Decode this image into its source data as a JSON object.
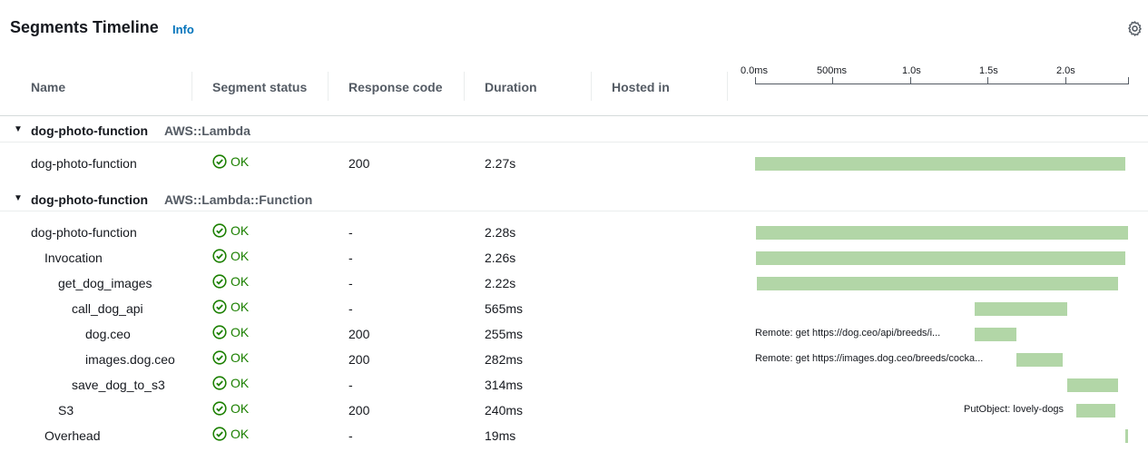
{
  "panel": {
    "title": "Segments Timeline",
    "info_label": "Info"
  },
  "columns": {
    "name": "Name",
    "status": "Segment status",
    "response": "Response code",
    "duration": "Duration",
    "hosted": "Hosted in"
  },
  "axis": {
    "ticks": [
      "0.0ms",
      "500ms",
      "1.0s",
      "1.5s",
      "2.0s"
    ]
  },
  "groups": [
    {
      "name": "dog-photo-function",
      "type": "AWS::Lambda"
    },
    {
      "name": "dog-photo-function",
      "type": "AWS::Lambda::Function"
    }
  ],
  "rows": [
    {
      "name": "dog-photo-function",
      "status": "OK",
      "response": "200",
      "duration": "2.27s",
      "bar_label": ""
    },
    {
      "name": "dog-photo-function",
      "status": "OK",
      "response": "-",
      "duration": "2.28s",
      "bar_label": ""
    },
    {
      "name": "Invocation",
      "status": "OK",
      "response": "-",
      "duration": "2.26s",
      "bar_label": ""
    },
    {
      "name": "get_dog_images",
      "status": "OK",
      "response": "-",
      "duration": "2.22s",
      "bar_label": ""
    },
    {
      "name": "call_dog_api",
      "status": "OK",
      "response": "-",
      "duration": "565ms",
      "bar_label": ""
    },
    {
      "name": "dog.ceo",
      "status": "OK",
      "response": "200",
      "duration": "255ms",
      "bar_label": "Remote: get https://dog.ceo/api/breeds/i..."
    },
    {
      "name": "images.dog.ceo",
      "status": "OK",
      "response": "200",
      "duration": "282ms",
      "bar_label": "Remote: get https://images.dog.ceo/breeds/cocka..."
    },
    {
      "name": "save_dog_to_s3",
      "status": "OK",
      "response": "-",
      "duration": "314ms",
      "bar_label": ""
    },
    {
      "name": "S3",
      "status": "OK",
      "response": "200",
      "duration": "240ms",
      "bar_label": "PutObject: lovely-dogs"
    },
    {
      "name": "Overhead",
      "status": "OK",
      "response": "-",
      "duration": "19ms",
      "bar_label": ""
    }
  ],
  "colors": {
    "ok": "#1d8102",
    "bar": "#b2d6a7",
    "link": "#0073bb"
  }
}
